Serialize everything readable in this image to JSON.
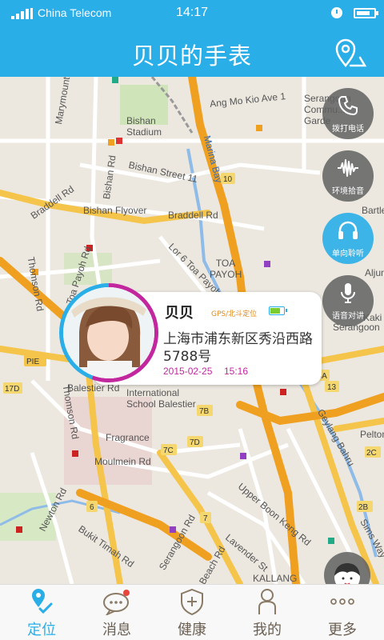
{
  "status_bar": {
    "carrier": "China Telecom",
    "time": "14:17"
  },
  "header": {
    "title": "贝贝的手表",
    "location_icon": "map-pin-icon"
  },
  "map": {
    "labels": [
      "Marymount Rd",
      "Bishan Stadium",
      "Ang Mo Kio Ave 1",
      "Serangoon Commu... Garde",
      "Bishan Rd",
      "Bishan Street 11",
      "Marina Bay",
      "Braddell Rd",
      "Bishan Flyover",
      "Braddell Rd",
      "Toa Payoh Rd",
      "Lor 6 Toa Payoh",
      "TOA PAYOH",
      "Thomson Rd",
      "Balestier Rd",
      "International School Balestier",
      "Fragrance",
      "Moulmein Rd",
      "Thomson Rd",
      "Newton Rd",
      "Bukit Timah Rd",
      "Serangoon Rd",
      "Beach Rd",
      "Geylang Bahru",
      "Upper Boon Keng Rd",
      "Lavender St",
      "KALLANG",
      "Sims Way",
      "Pelton",
      "Serangoon",
      "Bartley",
      "Aljunied",
      "Kaki Bukit"
    ],
    "road_shields": [
      "10",
      "7B",
      "7D",
      "7C",
      "15A",
      "17D",
      "2C",
      "13",
      "2B",
      "PIE",
      "6",
      "7"
    ]
  },
  "actions": [
    {
      "label": "拨打电话",
      "icon": "phone-icon",
      "active": false
    },
    {
      "label": "环境拾音",
      "icon": "sound-wave-icon",
      "active": false
    },
    {
      "label": "单向聆听",
      "icon": "headphones-icon",
      "active": true
    },
    {
      "label": "语音对讲",
      "icon": "microphone-icon",
      "active": false
    }
  ],
  "popup": {
    "name": "贝贝",
    "source": "GPS/北斗定位",
    "battery_level": 0.75,
    "address": "上海市浦东新区秀沿西路5788号",
    "date": "2015-02-25",
    "time": "15:16"
  },
  "tabs": [
    {
      "label": "定位",
      "icon": "location-pin-icon",
      "active": true
    },
    {
      "label": "消息",
      "icon": "chat-bubble-icon",
      "active": false
    },
    {
      "label": "健康",
      "icon": "shield-plus-icon",
      "active": false
    },
    {
      "label": "我的",
      "icon": "person-icon",
      "active": false
    },
    {
      "label": "更多",
      "icon": "more-dots-icon",
      "active": false
    }
  ],
  "colors": {
    "primary": "#2aaee8",
    "accent": "#c2279e",
    "source_label": "#e08a1a"
  }
}
